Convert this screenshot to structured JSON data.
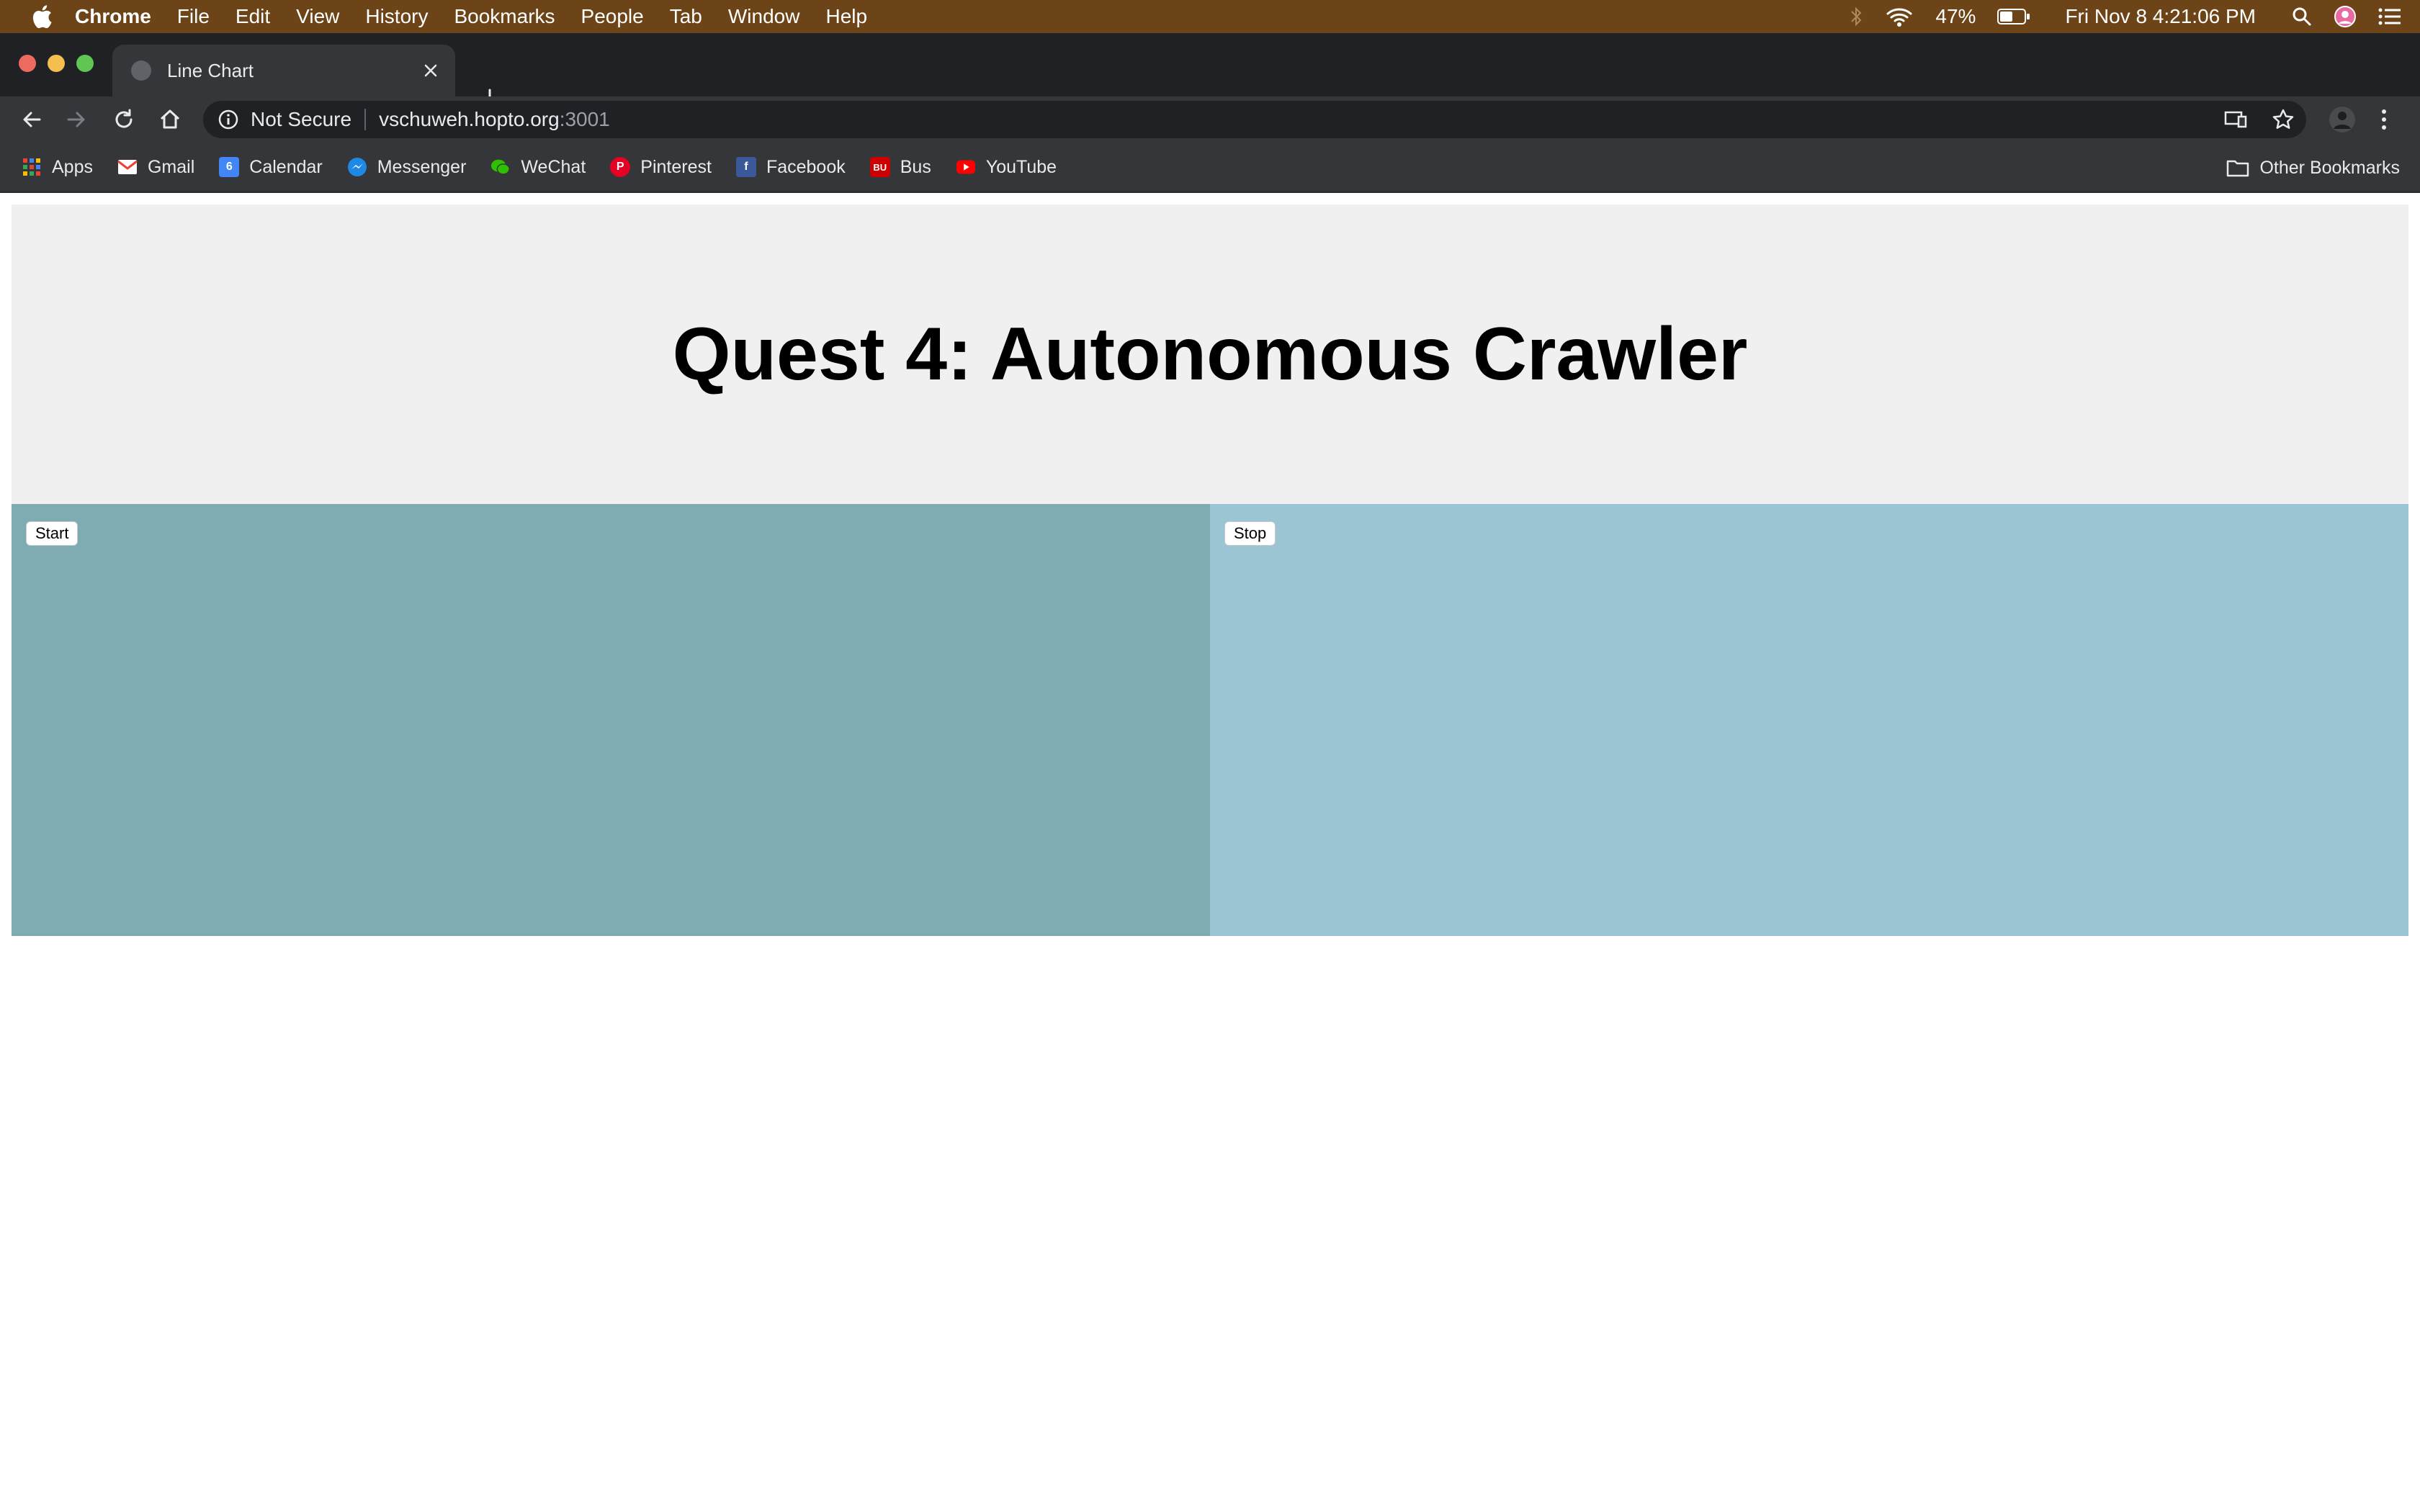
{
  "menubar": {
    "app": "Chrome",
    "items": [
      "File",
      "Edit",
      "View",
      "History",
      "Bookmarks",
      "People",
      "Tab",
      "Window",
      "Help"
    ],
    "battery": "47%",
    "datetime": "Fri Nov 8  4:21:06 PM"
  },
  "browser": {
    "tab_title": "Line Chart",
    "omnibox": {
      "security_label": "Not Secure",
      "host": "vschuweh.hopto.org",
      "port": ":3001"
    },
    "bookmarks": [
      {
        "label": "Apps",
        "icon": "apps-grid-icon",
        "color": "#4285f4"
      },
      {
        "label": "Gmail",
        "icon": "gmail-icon",
        "color": "#ea4335"
      },
      {
        "label": "Calendar",
        "icon": "calendar-icon",
        "color": "#4285f4"
      },
      {
        "label": "Messenger",
        "icon": "messenger-icon",
        "color": "#1e88e5"
      },
      {
        "label": "WeChat",
        "icon": "wechat-icon",
        "color": "#2dc100"
      },
      {
        "label": "Pinterest",
        "icon": "pinterest-icon",
        "color": "#e60023"
      },
      {
        "label": "Facebook",
        "icon": "facebook-icon",
        "color": "#3b5998"
      },
      {
        "label": "Bus",
        "icon": "bu-icon",
        "color": "#cc0000"
      },
      {
        "label": "YouTube",
        "icon": "youtube-icon",
        "color": "#ff0000"
      }
    ],
    "other_bookmarks": "Other Bookmarks"
  },
  "page": {
    "title": "Quest 4: Autonomous Crawler",
    "start_label": "Start",
    "stop_label": "Stop",
    "colors": {
      "header_band": "#f0f0f0",
      "left_panel": "#7fabb3",
      "right_panel": "#9bc5d3"
    }
  }
}
